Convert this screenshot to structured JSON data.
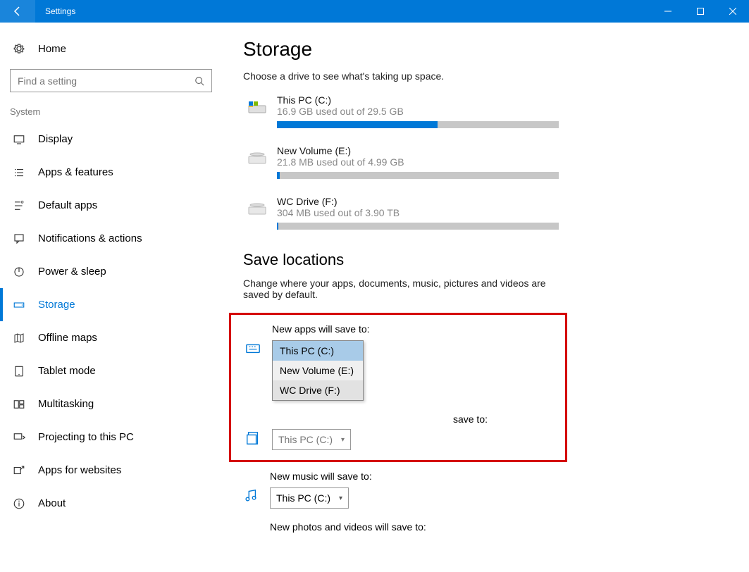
{
  "titlebar": {
    "title": "Settings"
  },
  "sidebar": {
    "home": "Home",
    "search_placeholder": "Find a setting",
    "category": "System",
    "items": [
      {
        "label": "Display"
      },
      {
        "label": "Apps & features"
      },
      {
        "label": "Default apps"
      },
      {
        "label": "Notifications & actions"
      },
      {
        "label": "Power & sleep"
      },
      {
        "label": "Storage",
        "selected": true
      },
      {
        "label": "Offline maps"
      },
      {
        "label": "Tablet mode"
      },
      {
        "label": "Multitasking"
      },
      {
        "label": "Projecting to this PC"
      },
      {
        "label": "Apps for websites"
      },
      {
        "label": "About"
      }
    ]
  },
  "main": {
    "heading": "Storage",
    "subtitle": "Choose a drive to see what's taking up space.",
    "drives": [
      {
        "name": "This PC (C:)",
        "usage": "16.9 GB used out of 29.5 GB",
        "pct": 57
      },
      {
        "name": "New Volume (E:)",
        "usage": "21.8 MB used out of 4.99 GB",
        "pct": 1
      },
      {
        "name": "WC Drive (F:)",
        "usage": "304 MB used out of 3.90 TB",
        "pct": 0.5
      }
    ],
    "save_heading": "Save locations",
    "save_sub": "Change where your apps, documents, music, pictures and videos are saved by default.",
    "apps_label": "New apps will save to:",
    "apps_options": [
      "This PC (C:)",
      "New Volume (E:)",
      "WC Drive (F:)"
    ],
    "docs_label": "New documents will save to:",
    "docs_label_visible": "save to:",
    "docs_value": "This PC (C:)",
    "music_label": "New music will save to:",
    "music_value": "This PC (C:)",
    "photos_label": "New photos and videos will save to:"
  }
}
